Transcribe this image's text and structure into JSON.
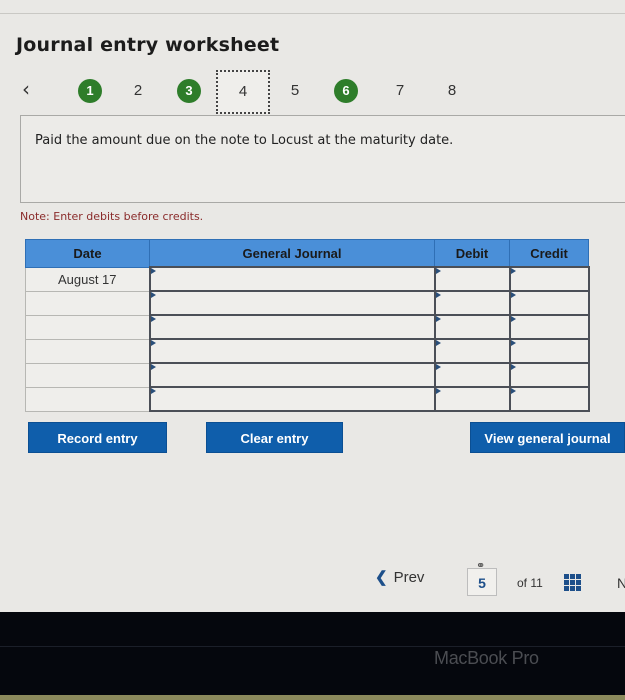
{
  "page": {
    "title": "Journal entry worksheet"
  },
  "steps": {
    "prev_icon": "chevron-left-icon",
    "items": [
      {
        "label": "1",
        "state": "completed"
      },
      {
        "label": "2",
        "state": "pending"
      },
      {
        "label": "3",
        "state": "completed"
      },
      {
        "label": "4",
        "state": "current"
      },
      {
        "label": "5",
        "state": "pending"
      },
      {
        "label": "6",
        "state": "completed"
      },
      {
        "label": "7",
        "state": "pending"
      },
      {
        "label": "8",
        "state": "pending"
      }
    ]
  },
  "transaction": {
    "description": "Paid the amount due on the note to Locust at the maturity date."
  },
  "note": "Note: Enter debits before credits.",
  "journal_table": {
    "columns": [
      "Date",
      "General Journal",
      "Debit",
      "Credit"
    ],
    "rows": [
      {
        "date": "August 17",
        "account": "",
        "debit": "",
        "credit": ""
      },
      {
        "date": "",
        "account": "",
        "debit": "",
        "credit": ""
      },
      {
        "date": "",
        "account": "",
        "debit": "",
        "credit": ""
      },
      {
        "date": "",
        "account": "",
        "debit": "",
        "credit": ""
      },
      {
        "date": "",
        "account": "",
        "debit": "",
        "credit": ""
      },
      {
        "date": "",
        "account": "",
        "debit": "",
        "credit": ""
      }
    ]
  },
  "buttons": {
    "record": "Record entry",
    "clear": "Clear entry",
    "view_journal": "View general journal"
  },
  "pagination": {
    "prev_label": "Prev",
    "current_page": "5",
    "total_label": "of 11",
    "next_peek": "N"
  },
  "device": {
    "brand": "MacBook Pro"
  },
  "colors": {
    "completed_step": "#2e7d2a",
    "table_header": "#4a8fd8",
    "button": "#0f5eab",
    "note_text": "#8a2b2b"
  }
}
